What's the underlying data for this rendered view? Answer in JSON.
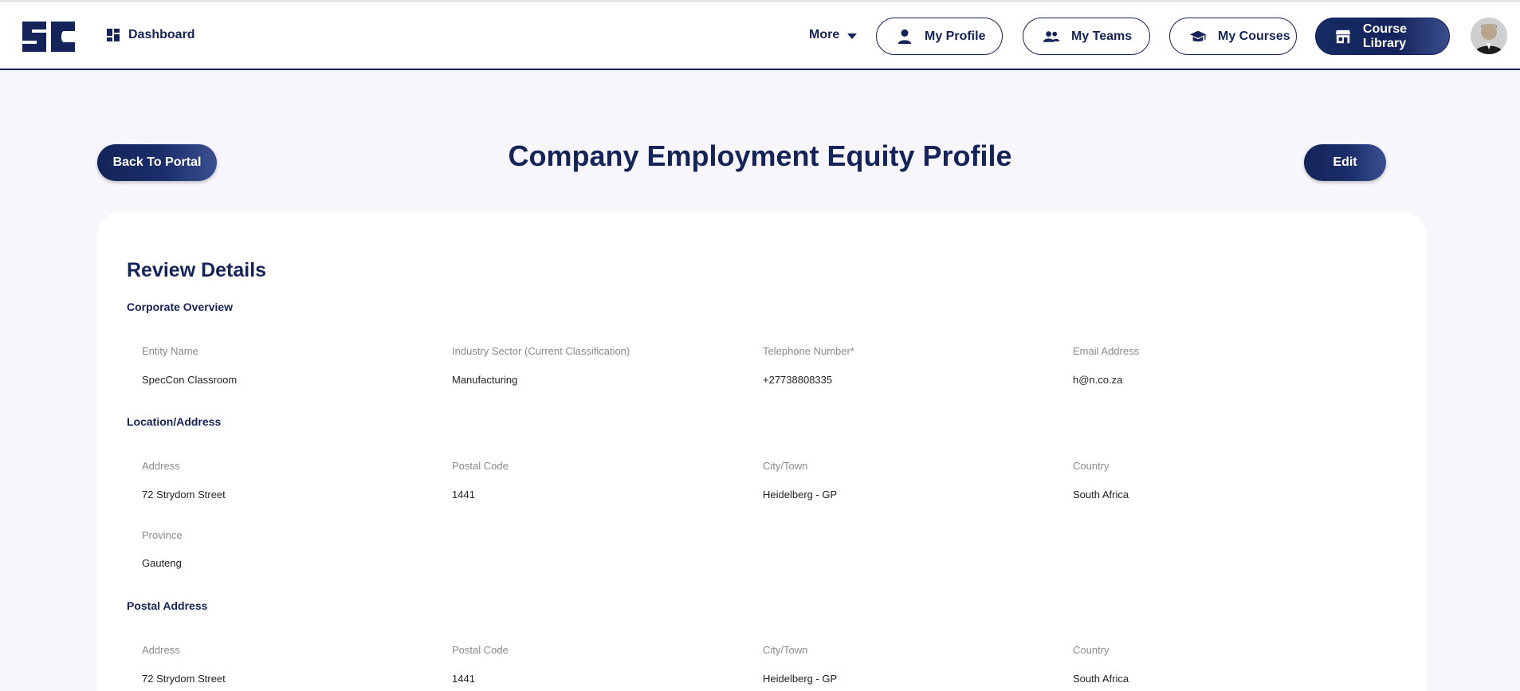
{
  "nav": {
    "logo_text": "SC",
    "dashboard": "Dashboard",
    "more": "More",
    "my_profile": "My Profile",
    "my_teams": "My Teams",
    "my_courses": "My Courses",
    "course_library": "Course Library"
  },
  "page": {
    "back_label": "Back To Portal",
    "title": "Company Employment Equity Profile",
    "edit_label": "Edit"
  },
  "card": {
    "title": "Review Details",
    "corporate_overview": {
      "heading": "Corporate Overview",
      "fields": [
        {
          "label": "Entity Name",
          "value": "SpecCon Classroom"
        },
        {
          "label": "Industry Sector (Current Classification)",
          "value": "Manufacturing"
        },
        {
          "label": "Telephone Number*",
          "value": "+27738808335"
        },
        {
          "label": "Email Address",
          "value": "h@n.co.za"
        }
      ]
    },
    "location": {
      "heading": "Location/Address",
      "fields": [
        {
          "label": "Address",
          "value": "72 Strydom Street"
        },
        {
          "label": "Postal Code",
          "value": "1441"
        },
        {
          "label": "City/Town",
          "value": "Heidelberg - GP"
        },
        {
          "label": "Country",
          "value": "South Africa"
        },
        {
          "label": "Province",
          "value": "Gauteng"
        }
      ]
    },
    "postal": {
      "heading": "Postal Address",
      "fields": [
        {
          "label": "Address",
          "value": "72 Strydom Street"
        },
        {
          "label": "Postal Code",
          "value": "1441"
        },
        {
          "label": "City/Town",
          "value": "Heidelberg - GP"
        },
        {
          "label": "Country",
          "value": "South Africa"
        }
      ]
    }
  },
  "colors": {
    "brand": "#14245a",
    "background": "#f7f6fb"
  }
}
